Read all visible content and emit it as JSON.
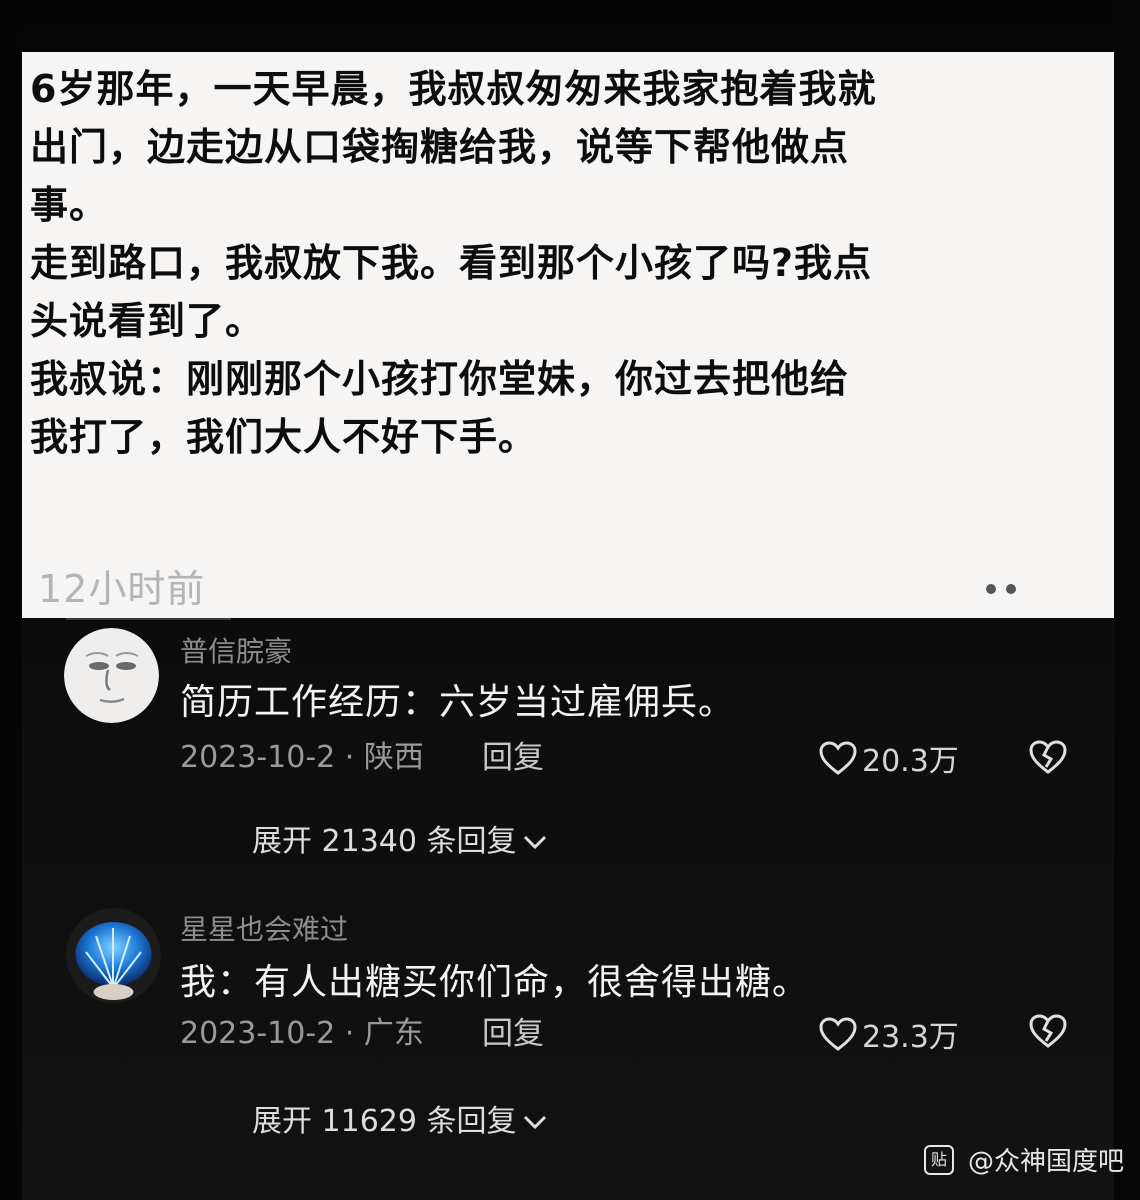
{
  "post": {
    "lines": [
      "6岁那年，一天早晨，我叔叔匆匆来我家抱着我就",
      "出门，边走边从口袋掏糖给我，说等下帮他做点",
      "事。",
      "走到路口，我叔放下我。看到那个小孩了吗?我点",
      "头说看到了。",
      "我叔说：刚刚那个小孩打你堂妹，你过去把他给",
      "我打了，我们大人不好下手。"
    ],
    "time": "12小时前",
    "more_icon": "more-dots-icon"
  },
  "comments": [
    {
      "username": "普信脘豪",
      "text": "简历工作经历：六岁当过雇佣兵。",
      "date_location": "2023-10-2 · 陕西",
      "reply_label": "回复",
      "likes": "20.3万",
      "expand_label": "展开 21340 条回复"
    },
    {
      "username": "星星也会难过",
      "text": "我：有人出糖买你们命，很舍得出糖。",
      "date_location": "2023-10-2 · 广东",
      "reply_label": "回复",
      "likes": "23.3万",
      "expand_label": "展开 11629 条回复"
    }
  ],
  "watermark": {
    "icon_text": "贴",
    "text": "@众神国度吧"
  },
  "colors": {
    "post_bg": "#f7f5f4",
    "screen_bg": "#0a0a0a",
    "comment_text": "#f2f2f2",
    "meta_text": "#9a9a9a"
  }
}
